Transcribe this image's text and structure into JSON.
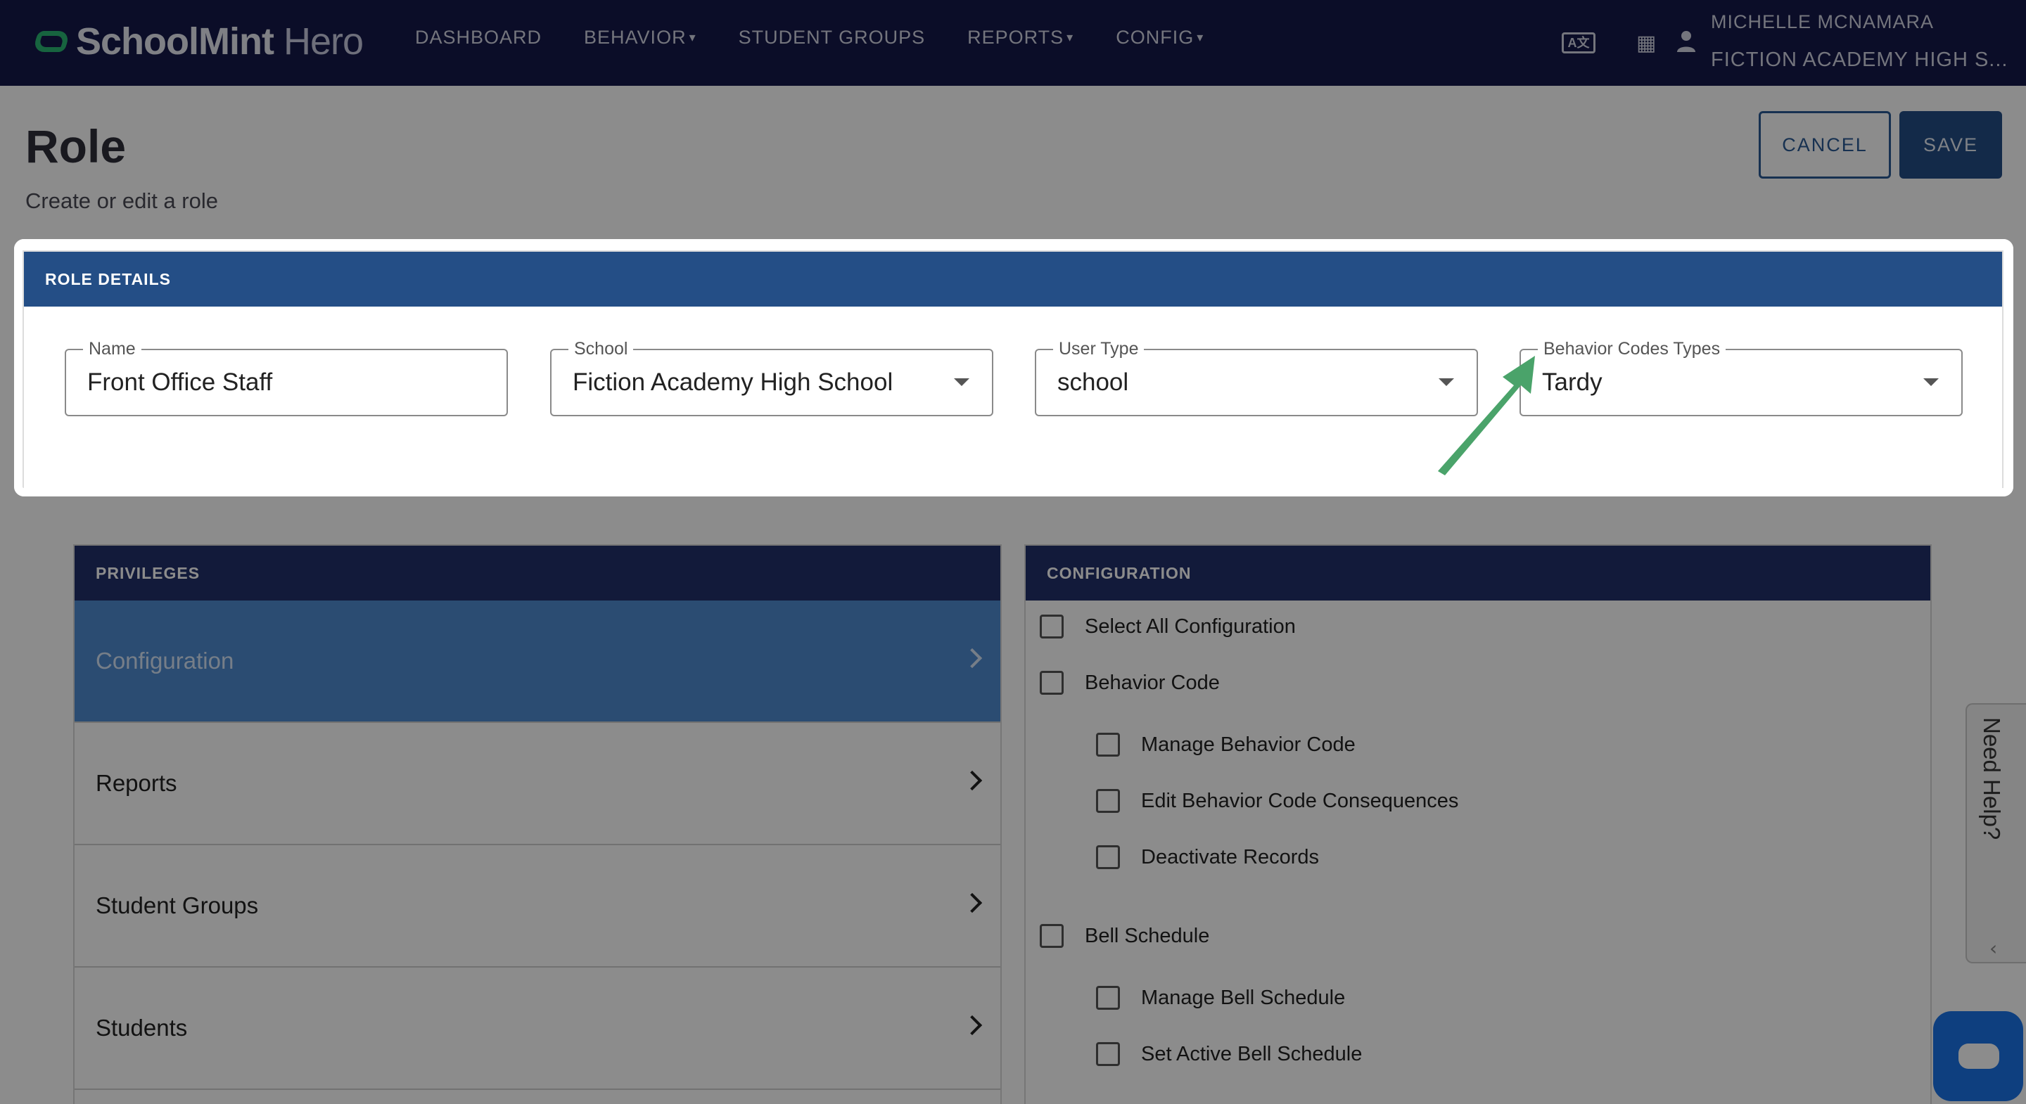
{
  "app": {
    "logo_bold": "SchoolMint",
    "logo_light": "Hero"
  },
  "nav": {
    "items": [
      {
        "label": "DASHBOARD",
        "has_caret": false
      },
      {
        "label": "BEHAVIOR",
        "has_caret": true
      },
      {
        "label": "STUDENT GROUPS",
        "has_caret": false
      },
      {
        "label": "REPORTS",
        "has_caret": true
      },
      {
        "label": "CONFIG",
        "has_caret": true
      }
    ],
    "caret_glyph": "▾",
    "icons": [
      "translate-icon",
      "calendar-icon",
      "user-icon"
    ],
    "translate_icon_text": "A文",
    "calendar_icon_glyph": "▦",
    "user_name": "MICHELLE MCNAMARA",
    "user_school": "FICTION ACADEMY HIGH S..."
  },
  "page": {
    "title": "Role",
    "subtitle": "Create or edit a role",
    "cancel_label": "CANCEL",
    "save_label": "SAVE"
  },
  "role_details": {
    "heading": "ROLE DETAILS",
    "fields": [
      {
        "label": "Name",
        "value": "Front Office Staff",
        "type": "text"
      },
      {
        "label": "School",
        "value": "Fiction Academy High School",
        "type": "select"
      },
      {
        "label": "User Type",
        "value": "school",
        "type": "select"
      },
      {
        "label": "Behavior Codes Types",
        "value": "Tardy",
        "type": "select"
      }
    ]
  },
  "privileges": {
    "heading": "PRIVILEGES",
    "items": [
      {
        "label": "Configuration",
        "active": true
      },
      {
        "label": "Reports",
        "active": false
      },
      {
        "label": "Student Groups",
        "active": false
      },
      {
        "label": "Students",
        "active": false
      }
    ]
  },
  "configuration": {
    "heading": "CONFIGURATION",
    "rows": [
      {
        "label": "Select All Configuration",
        "indent": 0
      },
      {
        "label": "Behavior Code",
        "indent": 0
      },
      {
        "label": "Manage Behavior Code",
        "indent": 1
      },
      {
        "label": "Edit Behavior Code Consequences",
        "indent": 1
      },
      {
        "label": "Deactivate Records",
        "indent": 1
      },
      {
        "label": "Bell Schedule",
        "indent": 0
      },
      {
        "label": "Manage Bell Schedule",
        "indent": 1
      },
      {
        "label": "Set Active Bell Schedule",
        "indent": 1
      }
    ]
  },
  "help": {
    "label": "Need Help?",
    "collapse_glyph": "‹"
  },
  "colors": {
    "nav_bg": "#15184a",
    "header_blue": "#244e86",
    "panel_head": "#22306b",
    "active_item": "#4f8ad0",
    "arrow_green": "#4aa36a",
    "chat_blue": "#1a73e8"
  }
}
